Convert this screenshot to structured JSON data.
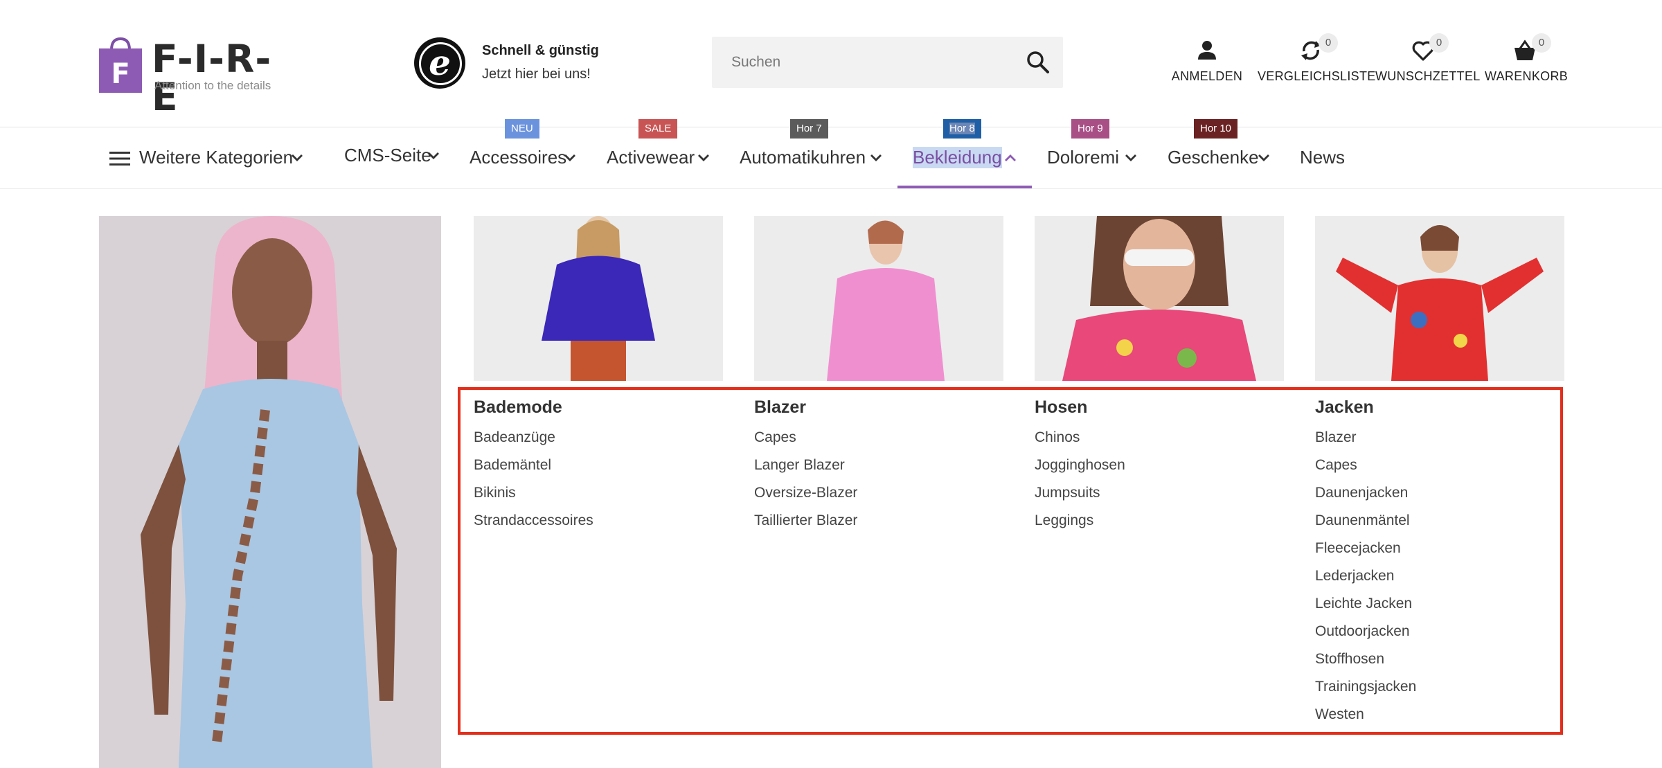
{
  "logo": {
    "letter": "F",
    "text": "F-I-R-E",
    "tagline": "Attention to the details"
  },
  "trust": {
    "title": "Schnell & günstig",
    "subtitle": "Jetzt hier bei uns!"
  },
  "search": {
    "placeholder": "Suchen"
  },
  "actions": [
    {
      "label": "ANMELDEN",
      "icon": "user-icon"
    },
    {
      "label": "VERGLEICHSLISTE",
      "icon": "compare-icon",
      "count": "0"
    },
    {
      "label": "WUNSCHZETTEL",
      "icon": "heart-icon",
      "count": "0"
    },
    {
      "label": "WARENKORB",
      "icon": "basket-icon",
      "count": "0"
    }
  ],
  "nav": {
    "more": "Weitere Kategorien",
    "items": [
      {
        "label": "CMS-Seite"
      },
      {
        "label": "Accessoires",
        "badge": "NEU",
        "badge_color": "#6b93dd"
      },
      {
        "label": "Activewear",
        "badge": "SALE",
        "badge_color": "#c85454"
      },
      {
        "label": "Automatikuhren",
        "badge": "Hor 7",
        "badge_color": "#5b5b5b"
      },
      {
        "label": "Bekleidung",
        "badge": "Hor 8",
        "badge_color": "#1f5fa5",
        "active": true
      },
      {
        "label": "Doloremi",
        "badge": "Hor 9",
        "badge_color": "#a84f86"
      },
      {
        "label": "Geschenke",
        "badge": "Hor 10",
        "badge_color": "#6a2222"
      },
      {
        "label": "News"
      }
    ]
  },
  "mega_menu": {
    "columns": [
      {
        "title": "Bademode",
        "items": [
          "Badeanzüge",
          "Bademäntel",
          "Bikinis",
          "Strandaccessoires"
        ]
      },
      {
        "title": "Blazer",
        "items": [
          "Capes",
          "Langer Blazer",
          "Oversize-Blazer",
          "Taillierter Blazer"
        ]
      },
      {
        "title": "Hosen",
        "items": [
          "Chinos",
          "Jogginghosen",
          "Jumpsuits",
          "Leggings"
        ]
      },
      {
        "title": "Jacken",
        "items": [
          "Blazer",
          "Capes",
          "Daunenjacken",
          "Daunenmäntel",
          "Fleecejacken",
          "Lederjacken",
          "Leichte Jacken",
          "Outdoorjacken",
          "Stoffhosen",
          "Trainingsjacken",
          "Westen"
        ]
      }
    ]
  },
  "colors": {
    "accent": "#8e5bb4",
    "highlight_border": "#e22f1c"
  }
}
